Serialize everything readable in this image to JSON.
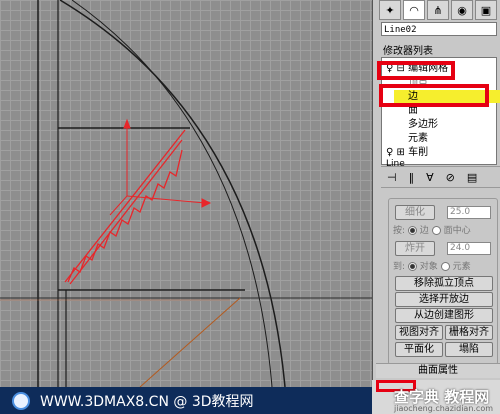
{
  "viewport": {
    "watermark_text": "WWW.3DMAX8.CN @ 3D教程网"
  },
  "panel": {
    "tabs": [
      "arrow-icon",
      "arc-icon",
      "hierarchy-icon",
      "motion-icon",
      "display-icon"
    ],
    "object_name": "Line02",
    "modifier_list_label": "修改器列表",
    "stack": {
      "modifier_1": "编辑网格",
      "sub_1": "顶点",
      "sub_2_selected": "边",
      "sub_3": "面",
      "sub_4": "多边形",
      "sub_5": "元素",
      "modifier_2": "车削",
      "base_object": "Line"
    },
    "tools": [
      "pin-icon",
      "|",
      "show-result-icon",
      "make-unique-icon",
      "remove-icon",
      "configure-icon"
    ],
    "rollout": {
      "weld_label": "细化",
      "weld_value": "25.0",
      "weld_by_label": "按:",
      "weld_opt_edge": "边",
      "weld_opt_face_center": "面中心",
      "explode_label": "炸开",
      "explode_value": "24.0",
      "explode_to_label": "到:",
      "explode_opt_object": "对象",
      "explode_opt_element": "元素",
      "btn_remove_isolated": "移除孤立顶点",
      "btn_select_open_edges": "选择开放边",
      "btn_create_shape": "从边创建图形",
      "btn_view_align": "视图对齐",
      "btn_grid_align": "栅格对齐",
      "btn_make_planar": "平面化",
      "btn_collapse": "塌陷",
      "header_surface": "曲面属性"
    },
    "site_mark": "查字典 教程网",
    "site_url": "jiaocheng.chazidian.com"
  },
  "colors": {
    "highlight_yellow": "#f6ee2d",
    "annotation_red": "#e60012",
    "edge_red": "#e8262a"
  }
}
